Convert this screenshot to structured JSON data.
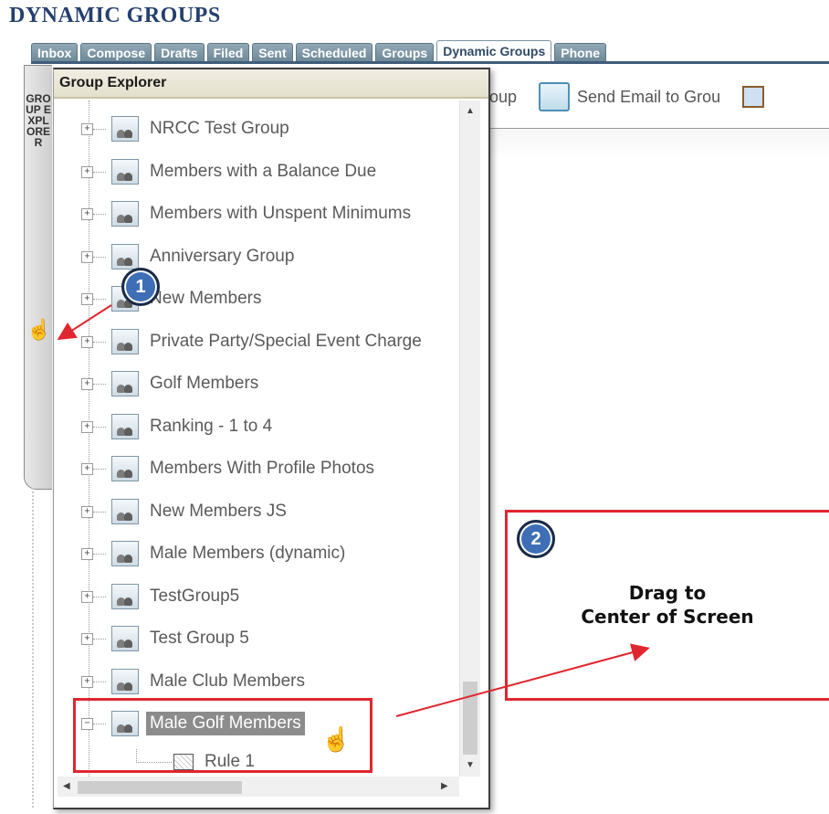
{
  "page_title": "DYNAMIC GROUPS",
  "tabs": [
    {
      "label": "Inbox"
    },
    {
      "label": "Compose"
    },
    {
      "label": "Drafts"
    },
    {
      "label": "Filed"
    },
    {
      "label": "Sent"
    },
    {
      "label": "Scheduled"
    },
    {
      "label": "Groups"
    },
    {
      "label": "Dynamic Groups",
      "active": true
    },
    {
      "label": "Phone"
    }
  ],
  "side_tab": {
    "label": "GROUP EXPLORER"
  },
  "toolbar": {
    "item_1": "roup",
    "item_2": "Send Email to Grou"
  },
  "explorer": {
    "title": "Group Explorer",
    "groups": [
      "NRCC Test Group",
      "Members with a Balance Due",
      "Members with Unspent Minimums",
      "Anniversary Group",
      "New Members",
      "Private Party/Special Event Charge",
      "Golf Members",
      "Ranking - 1 to 4",
      "Members With Profile Photos",
      "New Members JS",
      "Male Members (dynamic)",
      "TestGroup5",
      "Test Group 5",
      "Male Club Members",
      "Male Golf Members"
    ],
    "selected_group": "Male Golf Members",
    "rule_label": "Rule 1"
  },
  "annotations": {
    "badge_1": "1",
    "badge_2": "2",
    "drag_line_1": "Drag to",
    "drag_line_2": "Center of Screen",
    "color": "#e0262f"
  }
}
